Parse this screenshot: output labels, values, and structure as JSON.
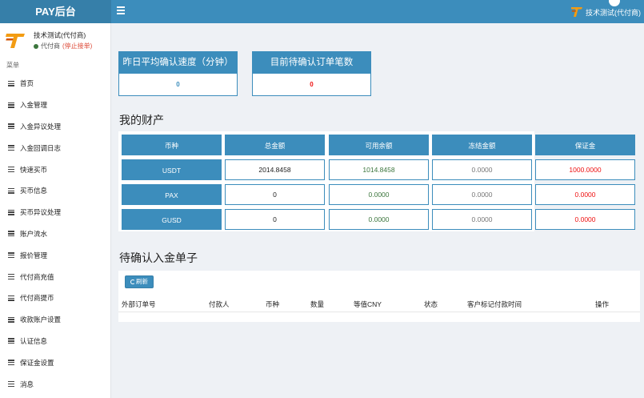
{
  "header": {
    "brand": "PAY后台",
    "user_name": "技术测试(代付商)"
  },
  "sidebar": {
    "user": {
      "name": "技术测试(代付商)",
      "status": "代付商",
      "stop_label": "(停止接单)"
    },
    "menu_header": "菜单",
    "items": [
      {
        "label": "首页"
      },
      {
        "label": "入金管理"
      },
      {
        "label": "入金异议处理"
      },
      {
        "label": "入金回调日志"
      },
      {
        "label": "快速买币"
      },
      {
        "label": "买币信息"
      },
      {
        "label": "买币异议处理"
      },
      {
        "label": "账户流水"
      },
      {
        "label": "报价管理"
      },
      {
        "label": "代付商充值"
      },
      {
        "label": "代付商提币"
      },
      {
        "label": "收款账户设置"
      },
      {
        "label": "认证信息"
      },
      {
        "label": "保证金设置"
      },
      {
        "label": "消息"
      }
    ]
  },
  "stats": {
    "avg_speed_title": "昨日平均确认速度（分钟）",
    "avg_speed_value": "0",
    "pending_count_title": "目前待确认订单笔数",
    "pending_count_value": "0"
  },
  "assets": {
    "title": "我的财产",
    "headers": [
      "币种",
      "总金额",
      "可用余额",
      "冻结金额",
      "保证金"
    ],
    "rows": [
      {
        "currency": "USDT",
        "total": "2014.8458",
        "available": "1014.8458",
        "frozen": "0.0000",
        "deposit": "1000.0000"
      },
      {
        "currency": "PAX",
        "total": "0",
        "available": "0.0000",
        "frozen": "0.0000",
        "deposit": "0.0000"
      },
      {
        "currency": "GUSD",
        "total": "0",
        "available": "0.0000",
        "frozen": "0.0000",
        "deposit": "0.0000"
      }
    ]
  },
  "pending": {
    "title": "待确认入金单子",
    "refresh_label": "刷新",
    "columns": [
      "外部订单号",
      "付款人",
      "币种",
      "数量",
      "等值CNY",
      "状态",
      "客户标记付款时间",
      "操作"
    ]
  },
  "colors": {
    "primary": "#3c8dbc",
    "brand_bg": "#367fa9",
    "available": "#3c763d",
    "deposit": "#ee1111"
  }
}
